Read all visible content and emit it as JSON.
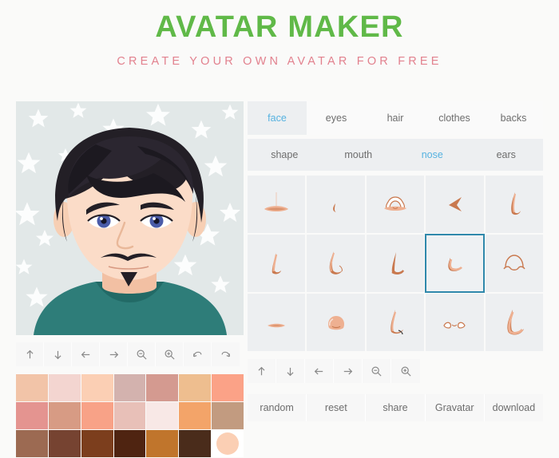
{
  "header": {
    "title": "AVATAR MAKER",
    "subtitle": "CREATE YOUR OWN AVATAR FOR FREE",
    "title_color": "#60b948",
    "subtitle_color": "#e2818e"
  },
  "preview": {
    "name": "avatar-preview",
    "background_color": "#e2e8e8",
    "hair_color": "#231f26",
    "skin_color": "#fbdcc8",
    "eye_color": "#4a5ba8",
    "shirt_color": "#2e7d79",
    "star_color": "#ffffff"
  },
  "left_toolbar": {
    "buttons": [
      {
        "name": "move-up-button",
        "icon": "arrow-up-icon",
        "label": "move up"
      },
      {
        "name": "move-down-button",
        "icon": "arrow-down-icon",
        "label": "move down"
      },
      {
        "name": "move-left-button",
        "icon": "arrow-left-icon",
        "label": "move left"
      },
      {
        "name": "move-right-button",
        "icon": "arrow-right-icon",
        "label": "move right"
      },
      {
        "name": "zoom-out-button",
        "icon": "zoom-out-icon",
        "label": "zoom out"
      },
      {
        "name": "zoom-in-button",
        "icon": "zoom-in-icon",
        "label": "zoom in"
      },
      {
        "name": "undo-button",
        "icon": "undo-icon",
        "label": "undo"
      },
      {
        "name": "redo-button",
        "icon": "redo-icon",
        "label": "redo"
      }
    ]
  },
  "right_toolbar": {
    "buttons": [
      {
        "name": "item-move-up-button",
        "icon": "arrow-up-icon",
        "label": "move up"
      },
      {
        "name": "item-move-down-button",
        "icon": "arrow-down-icon",
        "label": "move down"
      },
      {
        "name": "item-move-left-button",
        "icon": "arrow-left-icon",
        "label": "move left"
      },
      {
        "name": "item-move-right-button",
        "icon": "arrow-right-icon",
        "label": "move right"
      },
      {
        "name": "item-zoom-out-button",
        "icon": "zoom-out-icon",
        "label": "zoom out"
      },
      {
        "name": "item-zoom-in-button",
        "icon": "zoom-in-icon",
        "label": "zoom in"
      }
    ]
  },
  "palette": {
    "selected_color": "#fbcfb4",
    "colors": [
      "#f2c4a8",
      "#f3d5d0",
      "#fbcfb4",
      "#d3b2ae",
      "#d49a90",
      "#eebe8f",
      "#fba287",
      "#e49490",
      "#d79b84",
      "#f8a287",
      "#e8c0b8",
      "#f8e8e6",
      "#f3a469",
      "#c29b80",
      "#9c6a52",
      "#764331",
      "#7c3e1d",
      "#4f2411",
      "#c0752c",
      "#4a2c1b",
      "#fbcfb4"
    ]
  },
  "tabs": {
    "active": "face",
    "items": [
      {
        "label": "face",
        "active": true
      },
      {
        "label": "eyes",
        "active": false
      },
      {
        "label": "hair",
        "active": false
      },
      {
        "label": "clothes",
        "active": false
      },
      {
        "label": "backs",
        "active": false
      }
    ]
  },
  "subtabs": {
    "active": "nose",
    "items": [
      {
        "label": "shape",
        "active": false
      },
      {
        "label": "mouth",
        "active": false
      },
      {
        "label": "nose",
        "active": true
      },
      {
        "label": "ears",
        "active": false
      }
    ]
  },
  "item_grid": {
    "category": "nose",
    "columns": 5,
    "rows": 3,
    "selected_index": 8,
    "items": [
      {
        "name": "nose-option-1",
        "shape": "flat-wide"
      },
      {
        "name": "nose-option-2",
        "shape": "tiny-hook"
      },
      {
        "name": "nose-option-3",
        "shape": "wide-nostrils"
      },
      {
        "name": "nose-option-4",
        "shape": "arrow-dark"
      },
      {
        "name": "nose-option-5",
        "shape": "tall-hook"
      },
      {
        "name": "nose-option-6",
        "shape": "straight-slim"
      },
      {
        "name": "nose-option-7",
        "shape": "curved-long"
      },
      {
        "name": "nose-option-8",
        "shape": "angular-point"
      },
      {
        "name": "nose-option-9",
        "shape": "short-curve"
      },
      {
        "name": "nose-option-10",
        "shape": "outline-round"
      },
      {
        "name": "nose-option-11",
        "shape": "flat-small"
      },
      {
        "name": "nose-option-12",
        "shape": "button-round"
      },
      {
        "name": "nose-option-13",
        "shape": "pointed-long"
      },
      {
        "name": "nose-option-14",
        "shape": "nostrils-only"
      },
      {
        "name": "nose-option-15",
        "shape": "thick-hook"
      }
    ],
    "item_color_light": "#eeb091",
    "item_color_dark": "#c9794f"
  },
  "actions": {
    "buttons": [
      {
        "name": "random-button",
        "label": "random"
      },
      {
        "name": "reset-button",
        "label": "reset"
      },
      {
        "name": "share-button",
        "label": "share"
      },
      {
        "name": "gravatar-button",
        "label": "Gravatar"
      },
      {
        "name": "download-button",
        "label": "download"
      }
    ]
  }
}
